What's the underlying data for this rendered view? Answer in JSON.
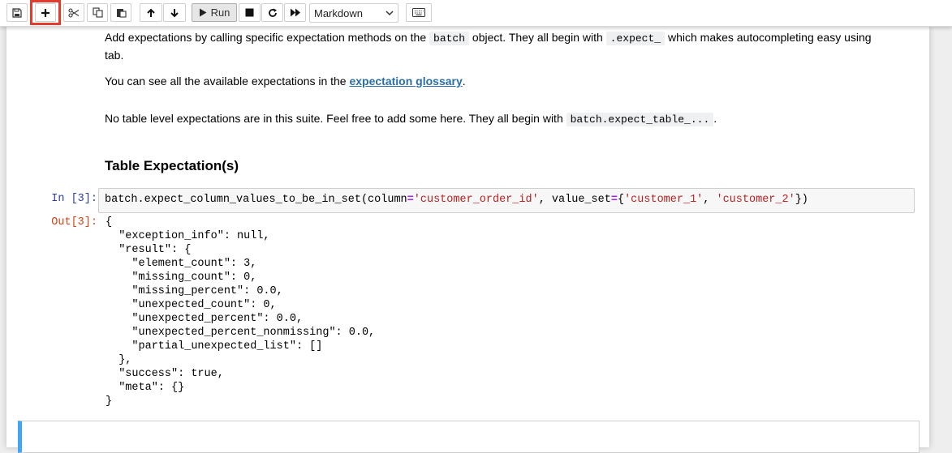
{
  "toolbar": {
    "buttons": [
      {
        "name": "save",
        "icon": "floppy-disk-icon"
      },
      {
        "name": "insert-cell",
        "icon": "plus-icon"
      },
      {
        "name": "cut",
        "icon": "scissors-icon"
      },
      {
        "name": "copy",
        "icon": "copy-icon"
      },
      {
        "name": "paste",
        "icon": "paste-icon"
      },
      {
        "name": "move-up",
        "icon": "arrow-up-icon"
      },
      {
        "name": "move-down",
        "icon": "arrow-down-icon"
      },
      {
        "name": "run",
        "icon": "play-icon"
      },
      {
        "name": "interrupt",
        "icon": "stop-icon"
      },
      {
        "name": "restart",
        "icon": "restart-icon"
      },
      {
        "name": "restart-run-all",
        "icon": "fast-forward-icon"
      },
      {
        "name": "command-palette",
        "icon": "keyboard-icon"
      }
    ],
    "run_label": "Run",
    "cell_type": "Markdown",
    "highlight_color": "#e53b2c"
  },
  "markdown": {
    "p1_before": "Add expectations by calling specific expectation methods on the ",
    "p1_code1": "batch",
    "p1_middle": " object. They all begin with ",
    "p1_code2": ".expect_",
    "p1_after": " which makes autocompleting easy using",
    "p1_line2": "tab.",
    "p2_before": "You can see all the available expectations in the ",
    "p2_link": "expectation glossary",
    "p2_after": ".",
    "p3_before": "No table level expectations are in this suite. Feel free to add some here. They all begin with ",
    "p3_code": "batch.expect_table_...",
    "p3_after": ".",
    "heading": "Table Expectation(s)"
  },
  "cell": {
    "in_prompt": "In [3]:",
    "code_func": "batch.expect_column_values_to_be_in_set(column",
    "code_eq1": "=",
    "code_str1": "'customer_order_id'",
    "code_mid": ", value_set",
    "code_eq2": "=",
    "code_brace_open": "{",
    "code_str2": "'customer_1'",
    "code_sep": ", ",
    "code_str3": "'customer_2'",
    "code_close": "})",
    "out_prompt": "Out[3]:",
    "output_text": "{\n  \"exception_info\": null,\n  \"result\": {\n    \"element_count\": 3,\n    \"missing_count\": 0,\n    \"missing_percent\": 0.0,\n    \"unexpected_count\": 0,\n    \"unexpected_percent\": 0.0,\n    \"unexpected_percent_nonmissing\": 0.0,\n    \"partial_unexpected_list\": []\n  },\n  \"success\": true,\n  \"meta\": {}\n}"
  },
  "colors": {
    "in_prompt": "#303f9f",
    "out_prompt": "#d84315",
    "link": "#296eaa",
    "active_cell_border": "#42a5f5"
  }
}
